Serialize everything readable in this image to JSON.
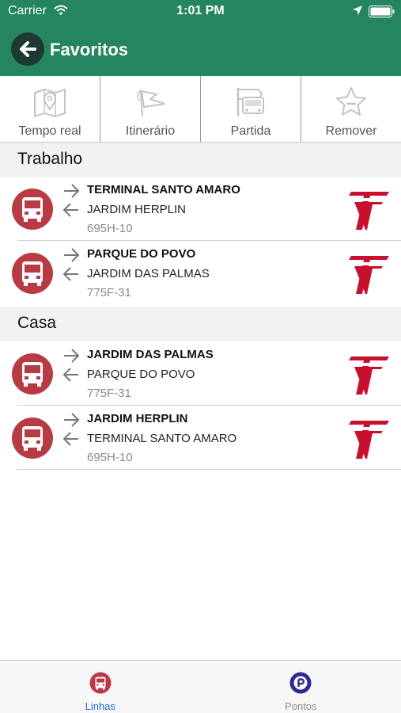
{
  "status_bar": {
    "carrier": "Carrier",
    "time": "1:01 PM"
  },
  "header": {
    "title": "Favoritos"
  },
  "toolbar": [
    {
      "label": "Tempo real",
      "icon": "map-icon"
    },
    {
      "label": "Itinerário",
      "icon": "route-flag-icon"
    },
    {
      "label": "Partida",
      "icon": "bus-stop-icon"
    },
    {
      "label": "Remover",
      "icon": "star-icon"
    }
  ],
  "sections": [
    {
      "title": "Trabalho",
      "routes": [
        {
          "destination": "TERMINAL SANTO AMARO",
          "origin": "JARDIM HERPLIN",
          "code": "695H-10"
        },
        {
          "destination": "PARQUE DO POVO",
          "origin": "JARDIM DAS PALMAS",
          "code": "775F-31"
        }
      ]
    },
    {
      "title": "Casa",
      "routes": [
        {
          "destination": "JARDIM DAS PALMAS",
          "origin": "PARQUE DO POVO",
          "code": "775F-31"
        },
        {
          "destination": "JARDIM HERPLIN",
          "origin": "TERMINAL SANTO AMARO",
          "code": "695H-10"
        }
      ]
    }
  ],
  "tab_bar": [
    {
      "label": "Linhas",
      "icon": "bus-icon",
      "active": true
    },
    {
      "label": "Pontos",
      "icon": "bus-stop-pin-icon",
      "active": false
    }
  ],
  "colors": {
    "header_green": "#24855f",
    "bus_red": "#b73a45",
    "logo_red": "#c8102e",
    "tab_active": "#1f6fc6",
    "tab_inactive": "#8e8e93"
  }
}
